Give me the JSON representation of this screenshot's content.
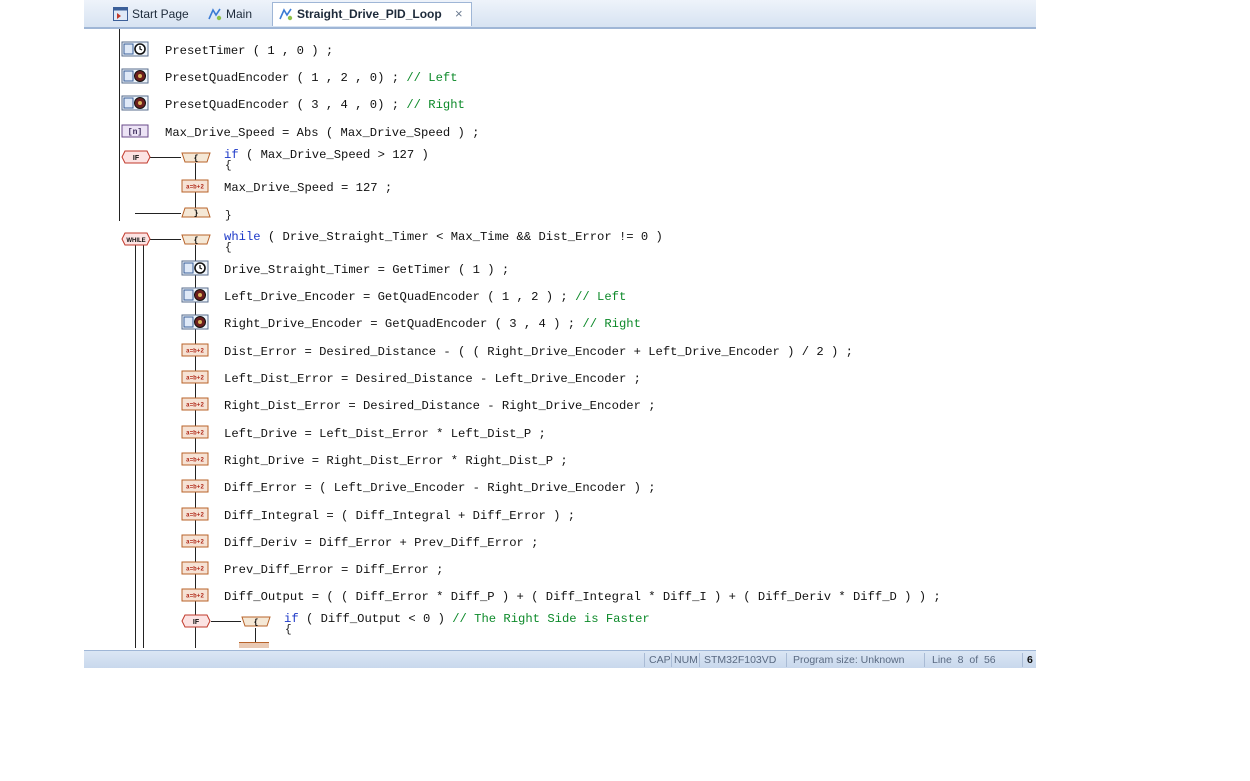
{
  "tabs": [
    {
      "label": "Start Page",
      "icon": "start-page-icon",
      "active": false
    },
    {
      "label": "Main",
      "icon": "program-icon",
      "active": false
    },
    {
      "label": "Straight_Drive_PID_Loop",
      "icon": "program-icon",
      "active": true,
      "close": "×"
    }
  ],
  "flowchart": {
    "labels": {
      "if": "IF",
      "while": "WHILE"
    },
    "lines": [
      {
        "code": "PresetTimer ( 1 , 0 ) ;"
      },
      {
        "code": "PresetQuadEncoder ( 1 , 2 , 0) ;",
        "comment": " // Left"
      },
      {
        "code": "PresetQuadEncoder ( 3 , 4 , 0) ;",
        "comment": " // Right"
      },
      {
        "code": "Max_Drive_Speed = Abs ( Max_Drive_Speed ) ;"
      },
      {
        "keyword": "if",
        "code": " ( Max_Drive_Speed > 127 )",
        "open": "{"
      },
      {
        "code": "Max_Drive_Speed = 127 ;"
      },
      {
        "close": "}"
      },
      {
        "keyword": "while",
        "code": " ( Drive_Straight_Timer < Max_Time && Dist_Error != 0 )",
        "open": "{"
      },
      {
        "code": "Drive_Straight_Timer = GetTimer ( 1 ) ;"
      },
      {
        "code": "Left_Drive_Encoder = GetQuadEncoder ( 1 , 2 ) ;",
        "comment": " // Left"
      },
      {
        "code": "Right_Drive_Encoder = GetQuadEncoder ( 3 , 4 ) ;",
        "comment": " // Right"
      },
      {
        "code": "Dist_Error = Desired_Distance - ( ( Right_Drive_Encoder + Left_Drive_Encoder ) / 2 ) ;"
      },
      {
        "code": "Left_Dist_Error = Desired_Distance - Left_Drive_Encoder ;"
      },
      {
        "code": "Right_Dist_Error = Desired_Distance - Right_Drive_Encoder ;"
      },
      {
        "code": "Left_Drive = Left_Dist_Error * Left_Dist_P ;"
      },
      {
        "code": "Right_Drive = Right_Dist_Error * Right_Dist_P ;"
      },
      {
        "code": "Diff_Error = ( Left_Drive_Encoder - Right_Drive_Encoder ) ;"
      },
      {
        "code": "Diff_Integral = ( Diff_Integral + Diff_Error ) ;"
      },
      {
        "code": "Diff_Deriv = Diff_Error + Prev_Diff_Error ;"
      },
      {
        "code": "Prev_Diff_Error = Diff_Error ;"
      },
      {
        "code": "Diff_Output = ( ( Diff_Error * Diff_P ) + ( Diff_Integral * Diff_I ) + ( Diff_Deriv * Diff_D ) ) ;"
      },
      {
        "keyword": "if",
        "code": " ( Diff_Output < 0 )",
        "comment": " // The Right Side is Faster",
        "open": "{"
      }
    ]
  },
  "status": {
    "cap": "CAP",
    "num": "NUM",
    "device": "STM32F103VD",
    "program_size": "Program size: Unknown",
    "line": "Line  8  of  56",
    "extra": "6"
  },
  "colors": {
    "keyword": "#1d39c8",
    "comment": "#0d8a2a",
    "tab_border": "#9fb6d6"
  }
}
